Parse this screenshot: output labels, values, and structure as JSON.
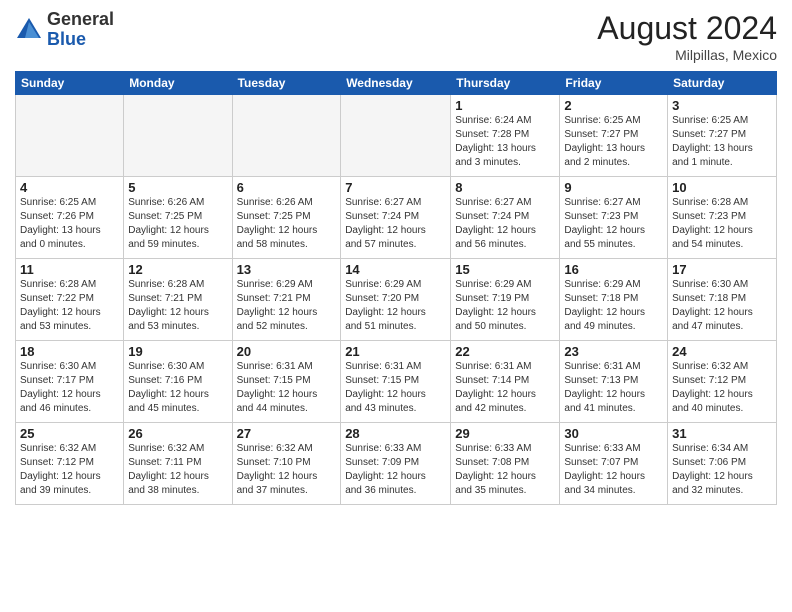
{
  "logo": {
    "general": "General",
    "blue": "Blue"
  },
  "header": {
    "month_year": "August 2024",
    "location": "Milpillas, Mexico"
  },
  "days_of_week": [
    "Sunday",
    "Monday",
    "Tuesday",
    "Wednesday",
    "Thursday",
    "Friday",
    "Saturday"
  ],
  "weeks": [
    [
      {
        "day": "",
        "info": ""
      },
      {
        "day": "",
        "info": ""
      },
      {
        "day": "",
        "info": ""
      },
      {
        "day": "",
        "info": ""
      },
      {
        "day": "1",
        "info": "Sunrise: 6:24 AM\nSunset: 7:28 PM\nDaylight: 13 hours\nand 3 minutes."
      },
      {
        "day": "2",
        "info": "Sunrise: 6:25 AM\nSunset: 7:27 PM\nDaylight: 13 hours\nand 2 minutes."
      },
      {
        "day": "3",
        "info": "Sunrise: 6:25 AM\nSunset: 7:27 PM\nDaylight: 13 hours\nand 1 minute."
      }
    ],
    [
      {
        "day": "4",
        "info": "Sunrise: 6:25 AM\nSunset: 7:26 PM\nDaylight: 13 hours\nand 0 minutes."
      },
      {
        "day": "5",
        "info": "Sunrise: 6:26 AM\nSunset: 7:25 PM\nDaylight: 12 hours\nand 59 minutes."
      },
      {
        "day": "6",
        "info": "Sunrise: 6:26 AM\nSunset: 7:25 PM\nDaylight: 12 hours\nand 58 minutes."
      },
      {
        "day": "7",
        "info": "Sunrise: 6:27 AM\nSunset: 7:24 PM\nDaylight: 12 hours\nand 57 minutes."
      },
      {
        "day": "8",
        "info": "Sunrise: 6:27 AM\nSunset: 7:24 PM\nDaylight: 12 hours\nand 56 minutes."
      },
      {
        "day": "9",
        "info": "Sunrise: 6:27 AM\nSunset: 7:23 PM\nDaylight: 12 hours\nand 55 minutes."
      },
      {
        "day": "10",
        "info": "Sunrise: 6:28 AM\nSunset: 7:23 PM\nDaylight: 12 hours\nand 54 minutes."
      }
    ],
    [
      {
        "day": "11",
        "info": "Sunrise: 6:28 AM\nSunset: 7:22 PM\nDaylight: 12 hours\nand 53 minutes."
      },
      {
        "day": "12",
        "info": "Sunrise: 6:28 AM\nSunset: 7:21 PM\nDaylight: 12 hours\nand 53 minutes."
      },
      {
        "day": "13",
        "info": "Sunrise: 6:29 AM\nSunset: 7:21 PM\nDaylight: 12 hours\nand 52 minutes."
      },
      {
        "day": "14",
        "info": "Sunrise: 6:29 AM\nSunset: 7:20 PM\nDaylight: 12 hours\nand 51 minutes."
      },
      {
        "day": "15",
        "info": "Sunrise: 6:29 AM\nSunset: 7:19 PM\nDaylight: 12 hours\nand 50 minutes."
      },
      {
        "day": "16",
        "info": "Sunrise: 6:29 AM\nSunset: 7:18 PM\nDaylight: 12 hours\nand 49 minutes."
      },
      {
        "day": "17",
        "info": "Sunrise: 6:30 AM\nSunset: 7:18 PM\nDaylight: 12 hours\nand 47 minutes."
      }
    ],
    [
      {
        "day": "18",
        "info": "Sunrise: 6:30 AM\nSunset: 7:17 PM\nDaylight: 12 hours\nand 46 minutes."
      },
      {
        "day": "19",
        "info": "Sunrise: 6:30 AM\nSunset: 7:16 PM\nDaylight: 12 hours\nand 45 minutes."
      },
      {
        "day": "20",
        "info": "Sunrise: 6:31 AM\nSunset: 7:15 PM\nDaylight: 12 hours\nand 44 minutes."
      },
      {
        "day": "21",
        "info": "Sunrise: 6:31 AM\nSunset: 7:15 PM\nDaylight: 12 hours\nand 43 minutes."
      },
      {
        "day": "22",
        "info": "Sunrise: 6:31 AM\nSunset: 7:14 PM\nDaylight: 12 hours\nand 42 minutes."
      },
      {
        "day": "23",
        "info": "Sunrise: 6:31 AM\nSunset: 7:13 PM\nDaylight: 12 hours\nand 41 minutes."
      },
      {
        "day": "24",
        "info": "Sunrise: 6:32 AM\nSunset: 7:12 PM\nDaylight: 12 hours\nand 40 minutes."
      }
    ],
    [
      {
        "day": "25",
        "info": "Sunrise: 6:32 AM\nSunset: 7:12 PM\nDaylight: 12 hours\nand 39 minutes."
      },
      {
        "day": "26",
        "info": "Sunrise: 6:32 AM\nSunset: 7:11 PM\nDaylight: 12 hours\nand 38 minutes."
      },
      {
        "day": "27",
        "info": "Sunrise: 6:32 AM\nSunset: 7:10 PM\nDaylight: 12 hours\nand 37 minutes."
      },
      {
        "day": "28",
        "info": "Sunrise: 6:33 AM\nSunset: 7:09 PM\nDaylight: 12 hours\nand 36 minutes."
      },
      {
        "day": "29",
        "info": "Sunrise: 6:33 AM\nSunset: 7:08 PM\nDaylight: 12 hours\nand 35 minutes."
      },
      {
        "day": "30",
        "info": "Sunrise: 6:33 AM\nSunset: 7:07 PM\nDaylight: 12 hours\nand 34 minutes."
      },
      {
        "day": "31",
        "info": "Sunrise: 6:34 AM\nSunset: 7:06 PM\nDaylight: 12 hours\nand 32 minutes."
      }
    ]
  ]
}
